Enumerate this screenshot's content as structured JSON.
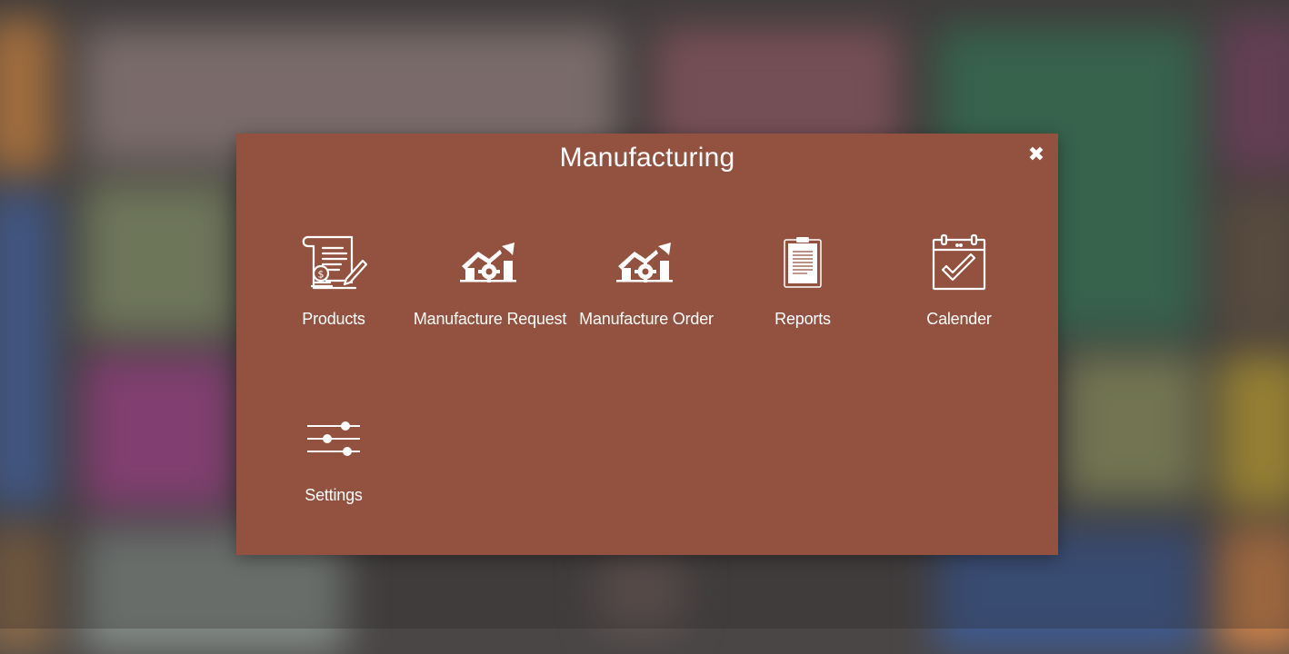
{
  "modal": {
    "title": "Manufacturing",
    "close_symbol": "✖",
    "background_color": "#935240"
  },
  "apps": [
    {
      "label": "Products",
      "icon": "products-document-icon"
    },
    {
      "label": "Manufacture Request",
      "icon": "factory-growth-icon"
    },
    {
      "label": "Manufacture Order",
      "icon": "factory-growth-icon"
    },
    {
      "label": "Reports",
      "icon": "clipboard-icon"
    },
    {
      "label": "Calender",
      "icon": "calendar-check-icon"
    },
    {
      "label": "Settings",
      "icon": "sliders-icon"
    }
  ]
}
